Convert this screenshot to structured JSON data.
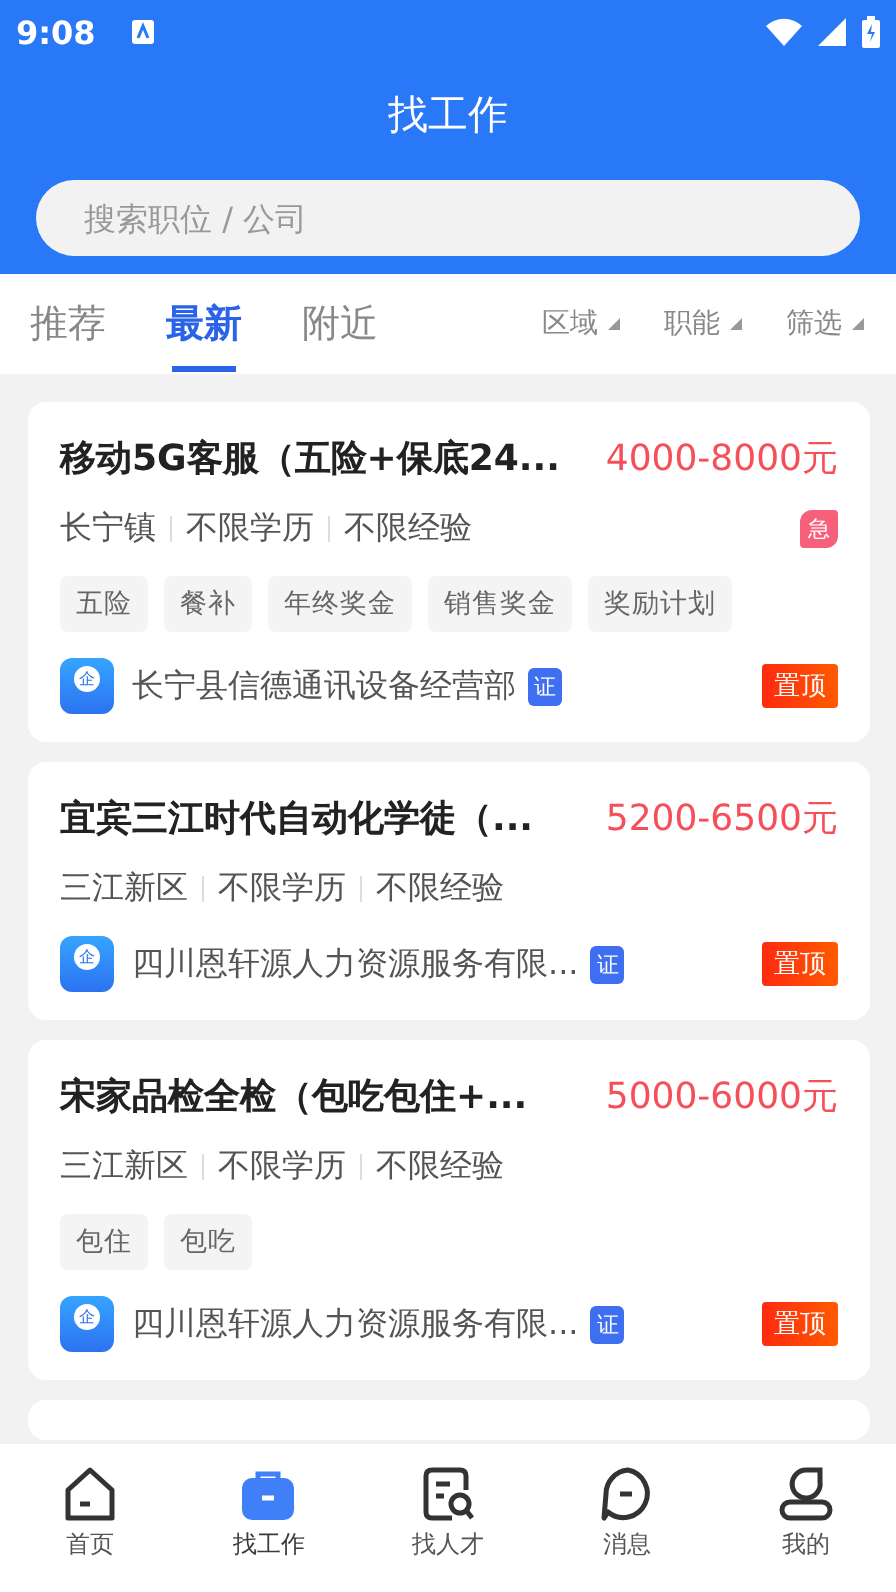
{
  "status_bar": {
    "time": "9:08"
  },
  "header": {
    "title": "找工作",
    "search": {
      "placeholder": "搜索职位 / 公司"
    }
  },
  "tabs": [
    {
      "label": "推荐",
      "selected": false
    },
    {
      "label": "最新",
      "selected": true
    },
    {
      "label": "附近",
      "selected": false
    }
  ],
  "filters": [
    {
      "label": "区域"
    },
    {
      "label": "职能"
    },
    {
      "label": "筛选"
    }
  ],
  "jobs": [
    {
      "title": "移动5G客服（五险+保底24...",
      "salary": "4000-8000元",
      "meta": [
        "长宁镇",
        "不限学历",
        "不限经验"
      ],
      "urgent": "急",
      "tags": [
        "五险",
        "餐补",
        "年终奖金",
        "销售奖金",
        "奖励计划"
      ],
      "logo_text": "企",
      "company": "长宁县信德通讯设备经营部",
      "verified": "证",
      "pinned": "置顶"
    },
    {
      "title": "宜宾三江时代自动化学徒（...",
      "salary": "5200-6500元",
      "meta": [
        "三江新区",
        "不限学历",
        "不限经验"
      ],
      "logo_text": "企",
      "company": "四川恩轩源人力资源服务有限...",
      "verified": "证",
      "pinned": "置顶"
    },
    {
      "title": "宋家品检全检（包吃包住+...",
      "salary": "5000-6000元",
      "meta": [
        "三江新区",
        "不限学历",
        "不限经验"
      ],
      "tags": [
        "包住",
        "包吃"
      ],
      "logo_text": "企",
      "company": "四川恩轩源人力资源服务有限...",
      "verified": "证",
      "pinned": "置顶"
    }
  ],
  "nav": [
    {
      "label": "首页",
      "kind": "home",
      "selected": false
    },
    {
      "label": "找工作",
      "kind": "jobs",
      "selected": true
    },
    {
      "label": "找人才",
      "kind": "talent",
      "selected": false
    },
    {
      "label": "消息",
      "kind": "message",
      "selected": false
    },
    {
      "label": "我的",
      "kind": "profile",
      "selected": false
    }
  ]
}
